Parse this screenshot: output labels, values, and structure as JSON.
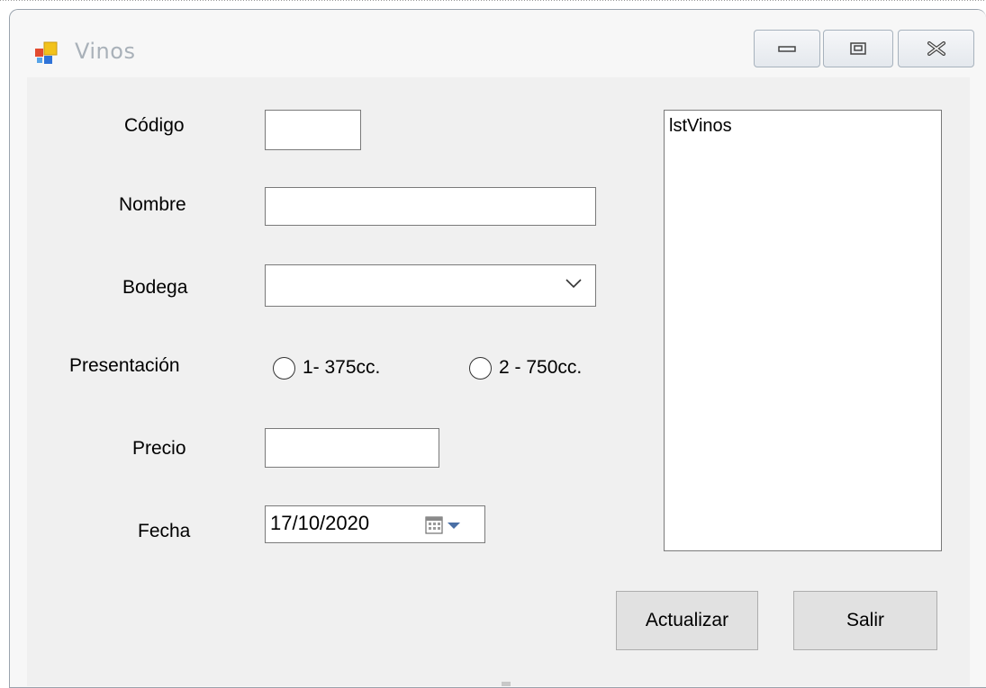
{
  "window": {
    "title": "Vinos",
    "controls": {
      "minimize": "minimize-icon",
      "maximize": "restore-icon",
      "close": "close-icon"
    }
  },
  "form": {
    "codigo": {
      "label": "Código",
      "value": ""
    },
    "nombre": {
      "label": "Nombre",
      "value": ""
    },
    "bodega": {
      "label": "Bodega",
      "selected": ""
    },
    "presentacion": {
      "label": "Presentación",
      "options": [
        {
          "label": "1- 375cc.",
          "checked": false
        },
        {
          "label": "2 - 750cc.",
          "checked": false
        }
      ]
    },
    "precio": {
      "label": "Precio",
      "value": ""
    },
    "fecha": {
      "label": "Fecha",
      "value": "17/10/2020"
    }
  },
  "listbox": {
    "name": "lstVinos",
    "items": []
  },
  "buttons": {
    "actualizar": "Actualizar",
    "salir": "Salir"
  },
  "colors": {
    "window_bg": "#f0f0f0",
    "title_text": "#a9b1b9",
    "button_bg": "#e1e1e1"
  }
}
